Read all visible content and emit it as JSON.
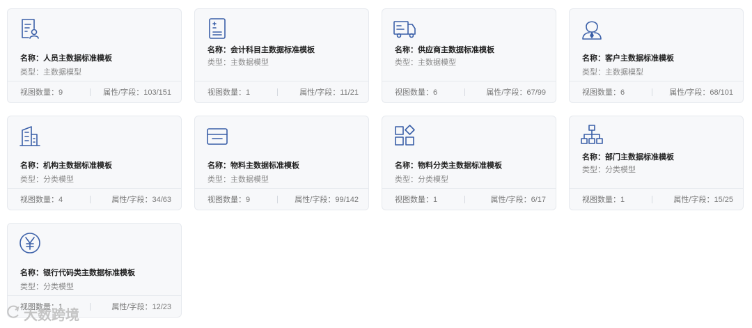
{
  "accent_color": "#3a5fa8",
  "labels": {
    "name_prefix": "名称：",
    "type_prefix": "类型：",
    "view_count_prefix": "视图数量：",
    "attr_field_prefix": "属性/字段："
  },
  "cards": [
    {
      "icon": "person-document-icon",
      "name": "人员主数据标准模板",
      "type": "主数据模型",
      "view_count": "9",
      "attr_fields": "103/151"
    },
    {
      "icon": "ledger-list-icon",
      "name": "会计科目主数据标准模板",
      "type": "主数据模型",
      "view_count": "1",
      "attr_fields": "11/21"
    },
    {
      "icon": "truck-icon",
      "name": "供应商主数据标准模板",
      "type": "主数据模型",
      "view_count": "6",
      "attr_fields": "67/99"
    },
    {
      "icon": "customer-user-icon",
      "name": "客户主数据标准模板",
      "type": "主数据模型",
      "view_count": "6",
      "attr_fields": "68/101"
    },
    {
      "icon": "building-icon",
      "name": "机构主数据标准模板",
      "type": "分类模型",
      "view_count": "4",
      "attr_fields": "34/63"
    },
    {
      "icon": "inbox-box-icon",
      "name": "物料主数据标准模板",
      "type": "主数据模型",
      "view_count": "9",
      "attr_fields": "99/142"
    },
    {
      "icon": "category-grid-icon",
      "name": "物料分类主数据标准模板",
      "type": "分类模型",
      "view_count": "1",
      "attr_fields": "6/17"
    },
    {
      "icon": "org-chart-icon",
      "name": "部门主数据标准模板",
      "type": "分类模型",
      "view_count": "1",
      "attr_fields": "15/25"
    },
    {
      "icon": "yuan-coin-icon",
      "name": "银行代码类主数据标准模板",
      "type": "分类模型",
      "view_count": "1",
      "attr_fields": "12/23"
    }
  ],
  "watermark": {
    "text": "大数跨境",
    "icon": "watermark-logo-icon"
  }
}
